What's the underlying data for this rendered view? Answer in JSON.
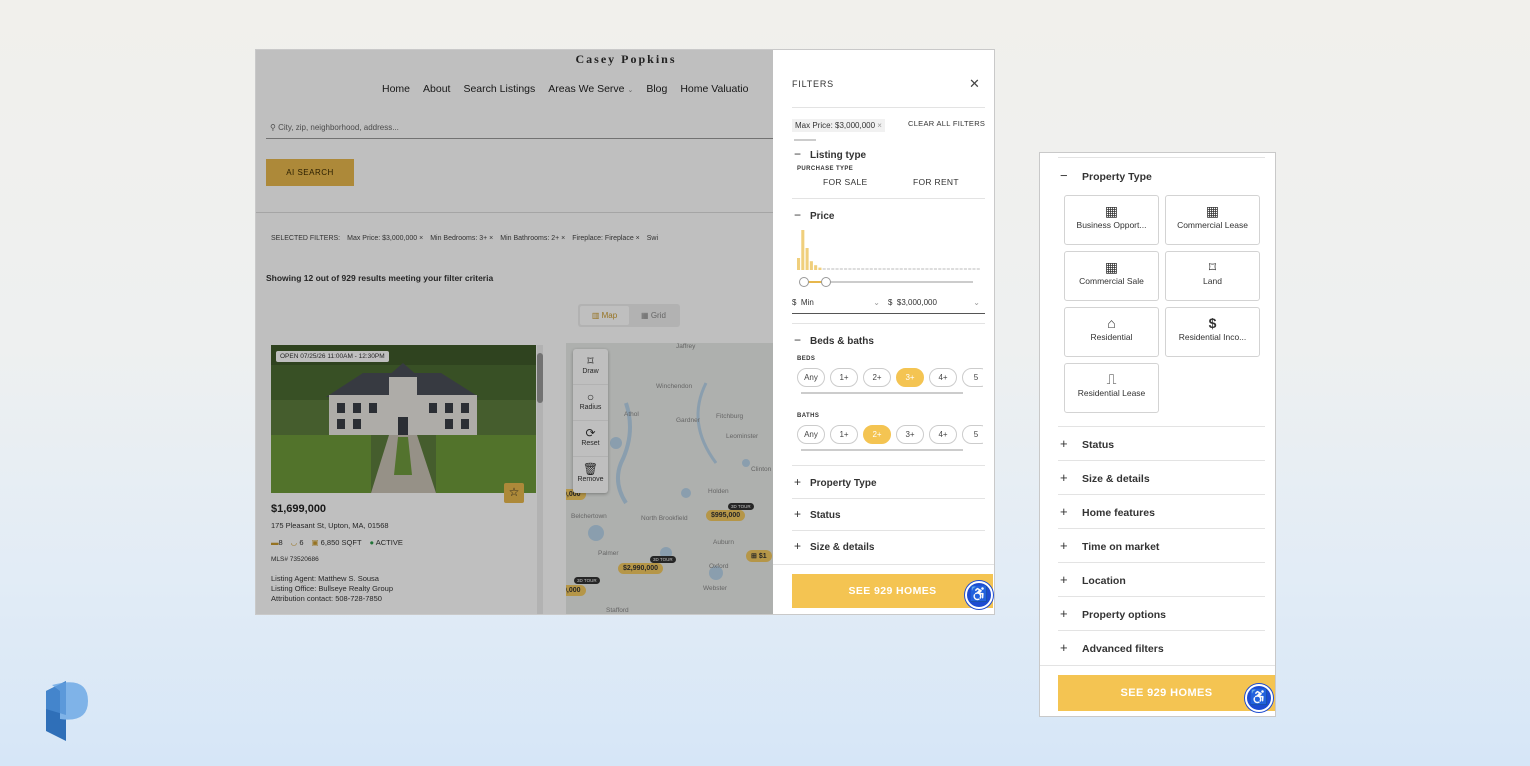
{
  "brand": {
    "logo_icon": "parcel-p-logo-icon"
  },
  "site": {
    "title": "Casey Popkins",
    "nav": [
      "Home",
      "About",
      "Search Listings",
      "Areas We Serve",
      "Blog",
      "Home Valuatio"
    ],
    "search_placeholder": "City, zip, neighborhood, address...",
    "ai_search": "AI SEARCH",
    "selected_filters_label": "SELECTED FILTERS:",
    "selected_filters": [
      "Max Price: $3,000,000",
      "Min Bedrooms: 3+",
      "Min Bathrooms: 2+",
      "Fireplace: Fireplace",
      "Swi"
    ],
    "results_text": "Showing 12 out of 929 results meeting your filter criteria",
    "view_toggle": {
      "map": "Map",
      "grid": "Grid"
    }
  },
  "listing": {
    "open_house": "OPEN 07/25/26 11:00AM - 12:30PM",
    "price": "$1,699,000",
    "address": "175 Pleasant St, Upton, MA, 01568",
    "beds": "8",
    "baths": "6",
    "sqft": "6,850 SQFT",
    "status": "ACTIVE",
    "mls": "MLS# 73520686",
    "agent": "Listing Agent: Matthew S. Sousa",
    "office": "Listing Office: Bullseye Realty Group",
    "attribution": "Attribution contact: 508-728-7850"
  },
  "map": {
    "tools": [
      {
        "label": "Draw",
        "icon": "draw-icon"
      },
      {
        "label": "Radius",
        "icon": "radius-icon"
      },
      {
        "label": "Reset",
        "icon": "reset-icon"
      },
      {
        "label": "Remove",
        "icon": "trash-icon"
      }
    ],
    "towns": [
      "Jaffrey",
      "Winchendon",
      "Athol",
      "Gardner",
      "Fitchburg",
      "Leominster",
      "Clinton",
      "Holden",
      "Belchertown",
      "North Brookfield",
      "Auburn",
      "Palmer",
      "Oxford",
      "Webster",
      "Stafford"
    ],
    "pins": [
      "$995,000",
      "$2,990,000",
      "0,000",
      "0,000",
      "$1"
    ],
    "tour_badge": "3D TOUR"
  },
  "filters": {
    "title": "FILTERS",
    "chip": "Max Price: $3,000,000",
    "clear_all": "CLEAR ALL FILTERS",
    "listing_type": {
      "label": "Listing type",
      "sub": "PURCHASE TYPE",
      "options": [
        "FOR SALE",
        "FOR RENT"
      ]
    },
    "price": {
      "label": "Price",
      "min_placeholder": "Min",
      "max_value": "$3,000,000",
      "currency": "$",
      "histogram": [
        0.3,
        1,
        0.55,
        0.22,
        0.12,
        0.06,
        0.05,
        0.05,
        0.05,
        0.05,
        0.05,
        0.05,
        0.05,
        0.05,
        0.05,
        0.05,
        0.05,
        0.05,
        0.05,
        0.05,
        0.05,
        0.05,
        0.05,
        0.05,
        0.05,
        0.05,
        0.05,
        0.05,
        0.05,
        0.05,
        0.05,
        0.05,
        0.05,
        0.05,
        0.05,
        0.05,
        0.05,
        0.05,
        0.05,
        0.05,
        0.05,
        0.05,
        0.05
      ]
    },
    "beds_baths": {
      "label": "Beds & baths",
      "beds_label": "BEDS",
      "baths_label": "BATHS",
      "options": [
        "Any",
        "1+",
        "2+",
        "3+",
        "4+",
        "5"
      ],
      "beds_selected": "3+",
      "baths_selected": "2+"
    },
    "collapsed": [
      "Property Type",
      "Status",
      "Size & details"
    ],
    "see_button": "SEE 929 HOMES"
  },
  "panel2": {
    "property_type": {
      "label": "Property Type",
      "types": [
        {
          "label": "Business Opport...",
          "icon": "building-icon"
        },
        {
          "label": "Commercial Lease",
          "icon": "building-icon"
        },
        {
          "label": "Commercial Sale",
          "icon": "building-icon"
        },
        {
          "label": "Land",
          "icon": "land-icon"
        },
        {
          "label": "Residential",
          "icon": "home-icon"
        },
        {
          "label": "Residential Inco...",
          "icon": "dollar-icon"
        },
        {
          "label": "Residential Lease",
          "icon": "door-icon"
        }
      ]
    },
    "sections": [
      "Status",
      "Size & details",
      "Home features",
      "Time on market",
      "Location",
      "Property options",
      "Advanced filters"
    ],
    "see_button": "SEE 929 HOMES"
  },
  "colors": {
    "accent": "#f4c452",
    "a11y": "#1c4bd1",
    "logo": "#2f6fb8"
  }
}
